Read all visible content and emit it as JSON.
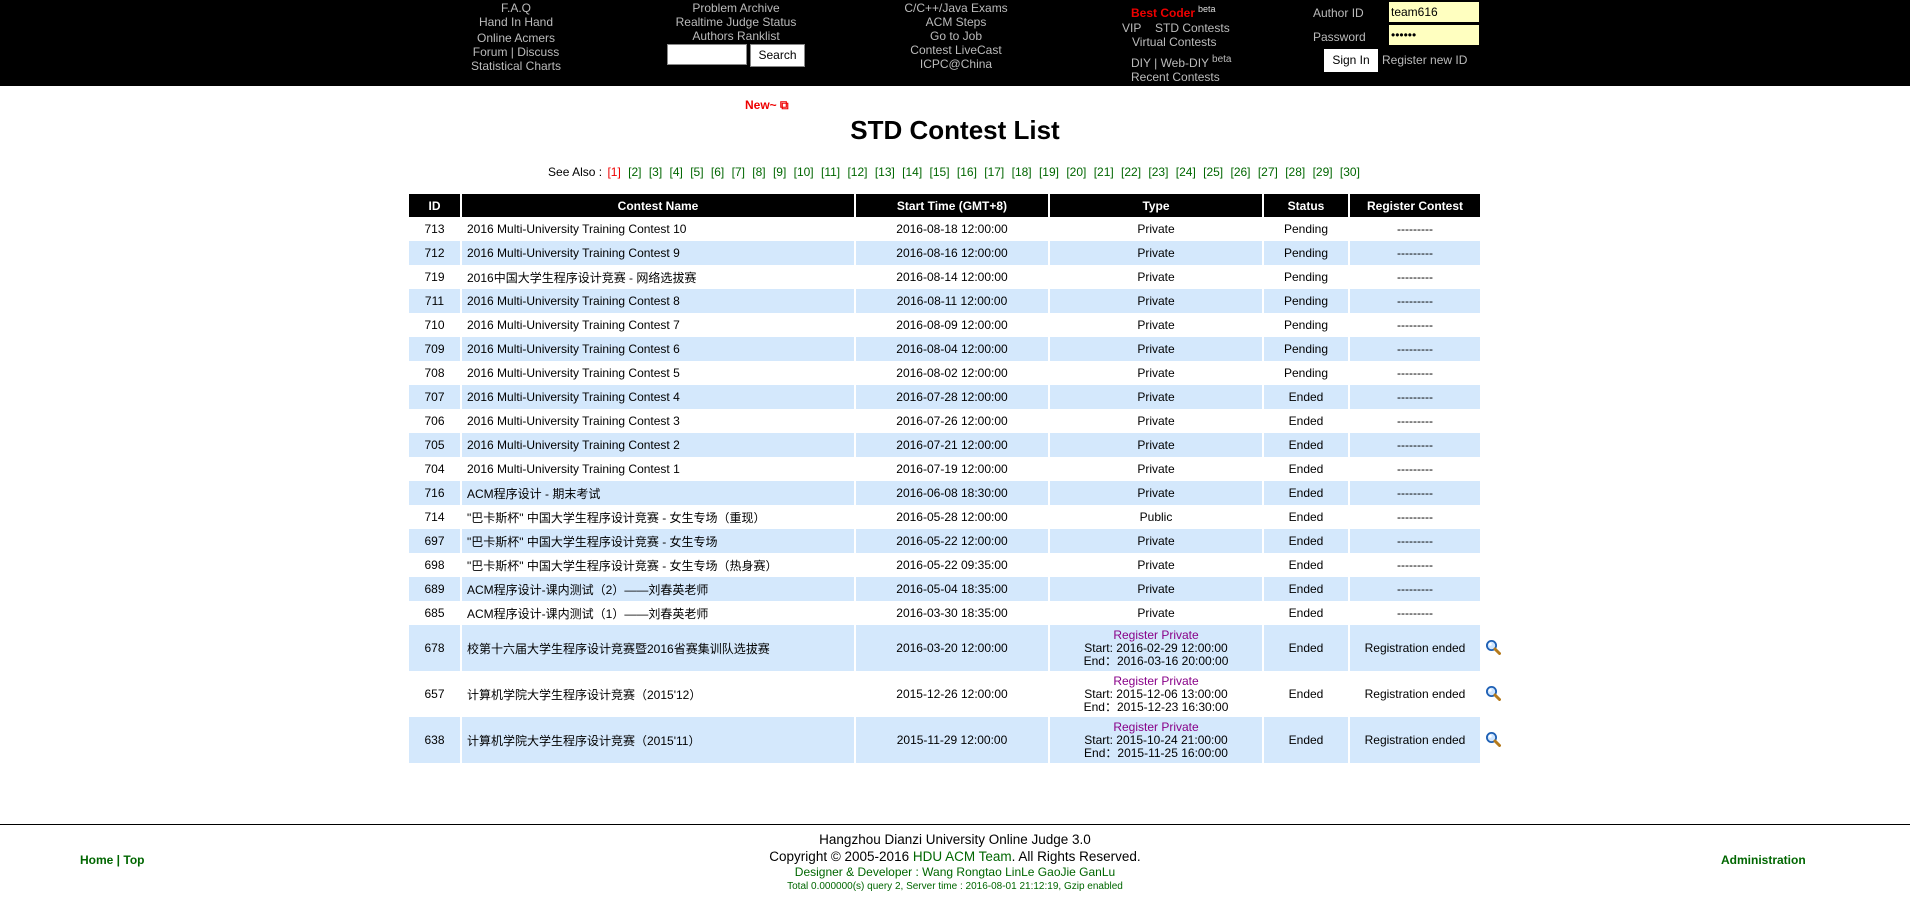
{
  "header": {
    "col1": [
      "F.A.Q",
      "Hand In Hand",
      "Online Acmers",
      "Forum | Discuss",
      "Statistical Charts"
    ],
    "col2": [
      "Problem Archive",
      "Realtime Judge Status",
      "Authors Ranklist"
    ],
    "search_label": "Search",
    "col3": [
      "C/C++/Java Exams",
      "ACM Steps",
      "Go to Job",
      "Contest LiveCast",
      "ICPC@China"
    ],
    "best_coder": "Best Coder",
    "best_coder_sup": "beta",
    "col4_vip": "VIP",
    "col4_std": "STD Contests",
    "col4_virtual": "Virtual Contests",
    "col4_diy": "DIY | Web-DIY",
    "col4_diy_sup": "beta",
    "col4_recent": "Recent Contests",
    "author_id_label": "Author ID",
    "author_id_value": "team616",
    "password_label": "Password",
    "password_value": "••••••",
    "sign_in": "Sign In",
    "register": "Register new ID"
  },
  "new_tag": "New~ ⧉",
  "page_title": "STD Contest List",
  "see_also_label": "See Also :",
  "pages": [
    "[1]",
    "[2]",
    "[3]",
    "[4]",
    "[5]",
    "[6]",
    "[7]",
    "[8]",
    "[9]",
    "[10]",
    "[11]",
    "[12]",
    "[13]",
    "[14]",
    "[15]",
    "[16]",
    "[17]",
    "[18]",
    "[19]",
    "[20]",
    "[21]",
    "[22]",
    "[23]",
    "[24]",
    "[25]",
    "[26]",
    "[27]",
    "[28]",
    "[29]",
    "[30]"
  ],
  "current_page": "[1]",
  "columns": [
    "ID",
    "Contest Name",
    "Start Time (GMT+8)",
    "Type",
    "Status",
    "Register Contest"
  ],
  "rows": [
    {
      "id": "713",
      "name": "2016 Multi-University Training Contest 10",
      "start": "2016-08-18 12:00:00",
      "type": "Private",
      "status": "Pending",
      "reg": "---------"
    },
    {
      "id": "712",
      "name": "2016 Multi-University Training Contest 9",
      "start": "2016-08-16 12:00:00",
      "type": "Private",
      "status": "Pending",
      "reg": "---------"
    },
    {
      "id": "719",
      "name": "2016中国大学生程序设计竞赛 - 网络选拔赛",
      "start": "2016-08-14 12:00:00",
      "type": "Private",
      "status": "Pending",
      "reg": "---------"
    },
    {
      "id": "711",
      "name": "2016 Multi-University Training Contest 8",
      "start": "2016-08-11 12:00:00",
      "type": "Private",
      "status": "Pending",
      "reg": "---------"
    },
    {
      "id": "710",
      "name": "2016 Multi-University Training Contest 7",
      "start": "2016-08-09 12:00:00",
      "type": "Private",
      "status": "Pending",
      "reg": "---------"
    },
    {
      "id": "709",
      "name": "2016 Multi-University Training Contest 6",
      "start": "2016-08-04 12:00:00",
      "type": "Private",
      "status": "Pending",
      "reg": "---------"
    },
    {
      "id": "708",
      "name": "2016 Multi-University Training Contest 5",
      "start": "2016-08-02 12:00:00",
      "type": "Private",
      "status": "Pending",
      "reg": "---------"
    },
    {
      "id": "707",
      "name": "2016 Multi-University Training Contest 4",
      "start": "2016-07-28 12:00:00",
      "type": "Private",
      "status": "Ended",
      "reg": "---------"
    },
    {
      "id": "706",
      "name": "2016 Multi-University Training Contest 3",
      "start": "2016-07-26 12:00:00",
      "type": "Private",
      "status": "Ended",
      "reg": "---------"
    },
    {
      "id": "705",
      "name": "2016 Multi-University Training Contest 2",
      "start": "2016-07-21 12:00:00",
      "type": "Private",
      "status": "Ended",
      "reg": "---------"
    },
    {
      "id": "704",
      "name": "2016 Multi-University Training Contest 1",
      "start": "2016-07-19 12:00:00",
      "type": "Private",
      "status": "Ended",
      "reg": "---------"
    },
    {
      "id": "716",
      "name": "ACM程序设计 - 期末考试",
      "start": "2016-06-08 18:30:00",
      "type": "Private",
      "status": "Ended",
      "reg": "---------"
    },
    {
      "id": "714",
      "name": "\"巴卡斯杯\" 中国大学生程序设计竞赛 - 女生专场（重现）",
      "start": "2016-05-28 12:00:00",
      "type": "Public",
      "status": "Ended",
      "reg": "---------"
    },
    {
      "id": "697",
      "name": "\"巴卡斯杯\" 中国大学生程序设计竞赛 - 女生专场",
      "start": "2016-05-22 12:00:00",
      "type": "Private",
      "status": "Ended",
      "reg": "---------"
    },
    {
      "id": "698",
      "name": "\"巴卡斯杯\" 中国大学生程序设计竞赛 - 女生专场（热身赛）",
      "start": "2016-05-22 09:35:00",
      "type": "Private",
      "status": "Ended",
      "reg": "---------"
    },
    {
      "id": "689",
      "name": "ACM程序设计-课内测试（2）——刘春英老师",
      "start": "2016-05-04 18:35:00",
      "type": "Private",
      "status": "Ended",
      "reg": "---------"
    },
    {
      "id": "685",
      "name": "ACM程序设计-课内测试（1）——刘春英老师",
      "start": "2016-03-30 18:35:00",
      "type": "Private",
      "status": "Ended",
      "reg": "---------"
    }
  ],
  "reg_rows": [
    {
      "id": "678",
      "name": "校第十六届大学生程序设计竞赛暨2016省赛集训队选拔赛",
      "start": "2016-03-20 12:00:00",
      "type": "Register Private",
      "reg_start": "Start: 2016-02-29 12:00:00",
      "reg_end": "End：2016-03-16 20:00:00",
      "status": "Ended",
      "reg": "Registration ended"
    },
    {
      "id": "657",
      "name": "计算机学院大学生程序设计竞赛（2015'12）",
      "start": "2015-12-26 12:00:00",
      "type": "Register Private",
      "reg_start": "Start: 2015-12-06 13:00:00",
      "reg_end": "End：2015-12-23 16:30:00",
      "status": "Ended",
      "reg": "Registration ended"
    },
    {
      "id": "638",
      "name": "计算机学院大学生程序设计竞赛（2015'11）",
      "start": "2015-11-29 12:00:00",
      "type": "Register Private",
      "reg_start": "Start: 2015-10-24 21:00:00",
      "reg_end": "End：2015-11-25 16:00:00",
      "status": "Ended",
      "reg": "Registration ended"
    }
  ],
  "footer": {
    "home": "Home",
    "sep": " | ",
    "top": "Top",
    "line1": "Hangzhou Dianzi University Online Judge 3.0",
    "line2_pre": "Copyright © 2005-2016 ",
    "line2_link": "HDU ACM Team",
    "line2_post": ". All Rights Reserved.",
    "line3": "Designer & Developer : Wang Rongtao LinLe GaoJie GanLu",
    "line4": "Total 0.000000(s) query 2, Server time : 2016-08-01 21:12:19, Gzip enabled",
    "admin": "Administration"
  },
  "colors": {
    "green": "#006600",
    "red": "#cc0033",
    "purple": "#880088",
    "row_blue": "#d4e8fc"
  }
}
